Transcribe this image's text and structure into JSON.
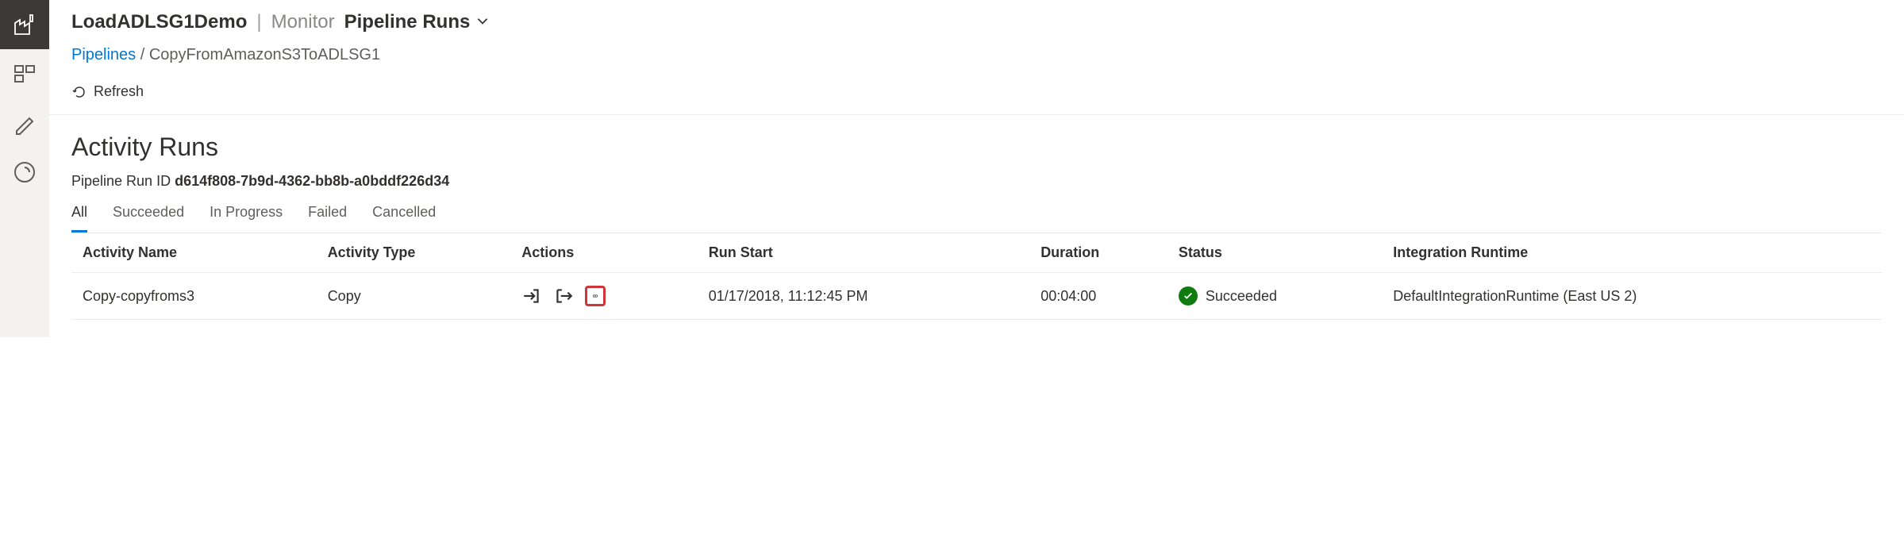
{
  "header": {
    "app": "LoadADLSG1Demo",
    "section": "Monitor",
    "page": "Pipeline Runs"
  },
  "breadcrumbs": {
    "root": "Pipelines",
    "current": "CopyFromAmazonS3ToADLSG1"
  },
  "toolbar": {
    "refresh": "Refresh"
  },
  "activity": {
    "title": "Activity Runs",
    "runid_label": "Pipeline Run ID",
    "runid": "d614f808-7b9d-4362-bb8b-a0bddf226d34"
  },
  "tabs": [
    "All",
    "Succeeded",
    "In Progress",
    "Failed",
    "Cancelled"
  ],
  "columns": {
    "name": "Activity Name",
    "type": "Activity Type",
    "actions": "Actions",
    "start": "Run Start",
    "duration": "Duration",
    "status": "Status",
    "runtime": "Integration Runtime"
  },
  "row": {
    "name": "Copy-copyfroms3",
    "type": "Copy",
    "start": "01/17/2018, 11:12:45 PM",
    "duration": "00:04:00",
    "status": "Succeeded",
    "runtime": "DefaultIntegrationRuntime (East US 2)"
  }
}
